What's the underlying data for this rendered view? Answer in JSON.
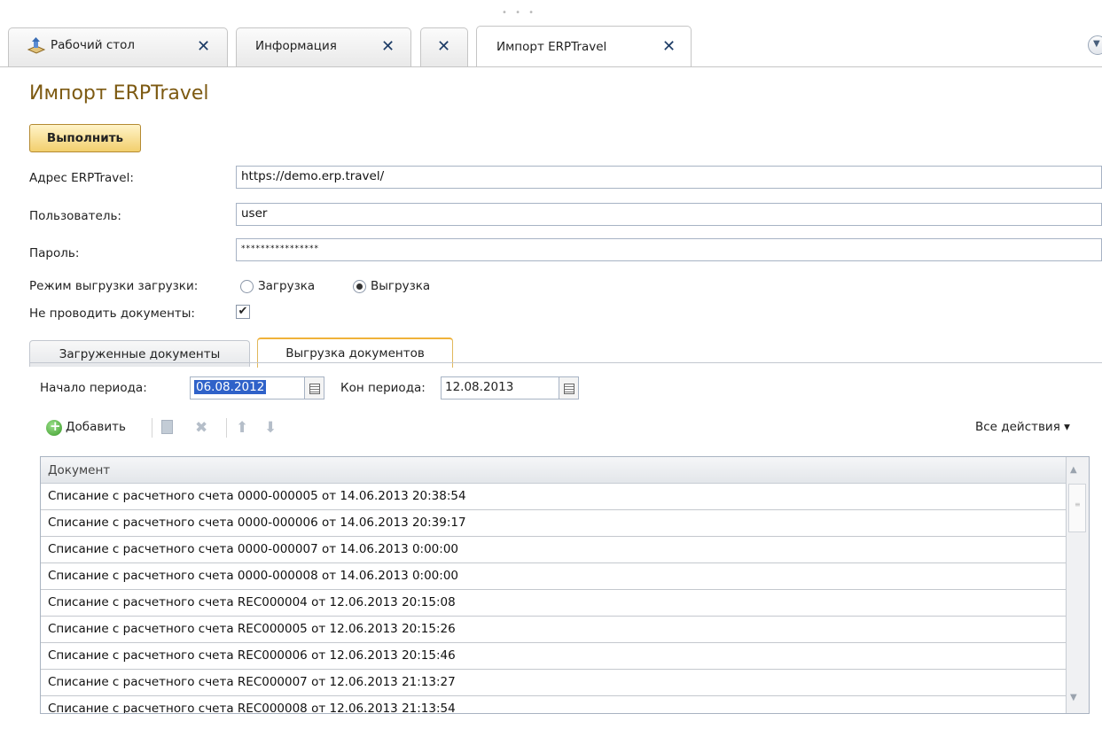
{
  "window_tabs": [
    {
      "label": "Рабочий стол",
      "icon": "desktop-icon"
    },
    {
      "label": "Информация"
    },
    {
      "label": ""
    },
    {
      "label": "Импорт ERPTravel"
    }
  ],
  "page": {
    "title": "Импорт ERPTravel",
    "execute_label": "Выполнить"
  },
  "form": {
    "address_label": "Адрес ERPTravel:",
    "address_value": "https://demo.erp.travel/",
    "user_label": "Пользователь:",
    "user_value": "user",
    "password_label": "Пароль:",
    "password_value": "****************",
    "mode_label": "Режим выгрузки загрузки:",
    "mode_options": [
      "Загрузка",
      "Выгрузка"
    ],
    "mode_selected": "Выгрузка",
    "no_post_label": "Не проводить документы:",
    "no_post_checked": true
  },
  "inner_tabs": [
    "Загруженные документы",
    "Выгрузка документов"
  ],
  "period": {
    "start_label": "Начало периода:",
    "start_value": "06.08.2012",
    "end_label": "Кон периода:",
    "end_value": "12.08.2013"
  },
  "toolbar": {
    "add_label": "Добавить",
    "all_actions_label": "Все действия ▾"
  },
  "table": {
    "column": "Документ",
    "rows": [
      "Списание с расчетного счета 0000-000005 от 14.06.2013 20:38:54",
      "Списание с расчетного счета 0000-000006 от 14.06.2013 20:39:17",
      "Списание с расчетного счета 0000-000007 от 14.06.2013 0:00:00",
      "Списание с расчетного счета 0000-000008 от 14.06.2013 0:00:00",
      "Списание с расчетного счета REC000004 от 12.06.2013 20:15:08",
      "Списание с расчетного счета REC000005 от 12.06.2013 20:15:26",
      "Списание с расчетного счета REC000006 от 12.06.2013 20:15:46",
      "Списание с расчетного счета REC000007 от 12.06.2013 21:13:27",
      "Списание с расчетного счета REC000008 от 12.06.2013 21:13:54"
    ]
  },
  "colors": {
    "title": "#7d5a12",
    "execute_button": "#f2cf6d",
    "selection": "#2f62c9",
    "tab_close": "#1d3c66"
  }
}
